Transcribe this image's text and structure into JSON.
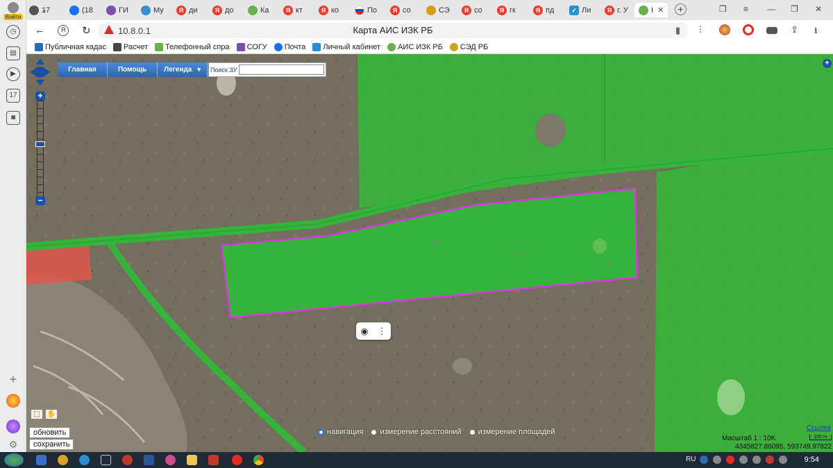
{
  "sidebar": {
    "login_label": "Войти",
    "badge_17": "17"
  },
  "tabs": [
    {
      "label": "17",
      "icon": "calendar-icon",
      "color": "#666"
    },
    {
      "label": "(18",
      "icon": "mail-icon",
      "color": "#1a6ff0"
    },
    {
      "label": "ГИ",
      "icon": "gis-icon",
      "color": "#7a4fb0"
    },
    {
      "label": "Му",
      "icon": "shield-icon",
      "color": "#3a8fd0"
    },
    {
      "label": "ди",
      "icon": "yandex-icon",
      "color": "#f23b2d"
    },
    {
      "label": "до",
      "icon": "yandex-icon",
      "color": "#f23b2d"
    },
    {
      "label": "Ка",
      "icon": "leaf-icon",
      "color": "#6ab04c"
    },
    {
      "label": "кт",
      "icon": "yandex-icon",
      "color": "#f23b2d"
    },
    {
      "label": "ко",
      "icon": "yandex-icon",
      "color": "#f23b2d"
    },
    {
      "label": "По",
      "icon": "flag-icon",
      "color": "#1a4fb0"
    },
    {
      "label": "со",
      "icon": "yandex-icon",
      "color": "#f23b2d"
    },
    {
      "label": "СЭ",
      "icon": "sed-icon",
      "color": "#d4a017"
    },
    {
      "label": "со",
      "icon": "yandex-icon",
      "color": "#f23b2d"
    },
    {
      "label": "гк",
      "icon": "yandex-icon",
      "color": "#f23b2d"
    },
    {
      "label": "пд",
      "icon": "yandex-icon",
      "color": "#f23b2d"
    },
    {
      "label": "Ли",
      "icon": "check-icon",
      "color": "#2a8fd0"
    },
    {
      "label": "г. У",
      "icon": "yandex-icon",
      "color": "#f23b2d"
    },
    {
      "label": "I",
      "icon": "leaf-icon",
      "color": "#6ab04c",
      "active": true
    }
  ],
  "address": {
    "url": "10.8.0.1",
    "title": "Карта АИС ИЗК РБ"
  },
  "bookmarks": [
    {
      "label": "Публичная кадас",
      "color": "#2a6fb3"
    },
    {
      "label": "Расчет",
      "color": "#444"
    },
    {
      "label": "Телефонный спра",
      "color": "#6ab04c"
    },
    {
      "label": "СОГУ",
      "color": "#7a4fb0"
    },
    {
      "label": "Почта",
      "color": "#1a6ff0"
    },
    {
      "label": "Личный кабинет",
      "color": "#2a8fd0"
    },
    {
      "label": "АИС ИЗК РБ",
      "color": "#6ab04c"
    },
    {
      "label": "СЭД РБ",
      "color": "#d4a017"
    }
  ],
  "map": {
    "menu": [
      "Главная",
      "Помощь",
      "Легенда"
    ],
    "search_label": "Поиск ЗУ",
    "buttons": {
      "refresh": "обновить",
      "save": "сохранить"
    },
    "modes": [
      {
        "label": "навигация",
        "selected": true
      },
      {
        "label": "измерение расстояний",
        "selected": false
      },
      {
        "label": "измерение площадей",
        "selected": false
      }
    ],
    "link": "Ссылка",
    "scale_label": "Масштаб 1 : 10K",
    "scale_bar": "100 m",
    "coords": "4345827.86095, 593749.97822",
    "colors": {
      "parcel_fill": "#36b33a",
      "selected_outline": "#d63adf",
      "restricted": "#e2564d",
      "terrain": "#746e5f"
    }
  },
  "taskbar": {
    "lang": "RU",
    "time": "9:54"
  }
}
